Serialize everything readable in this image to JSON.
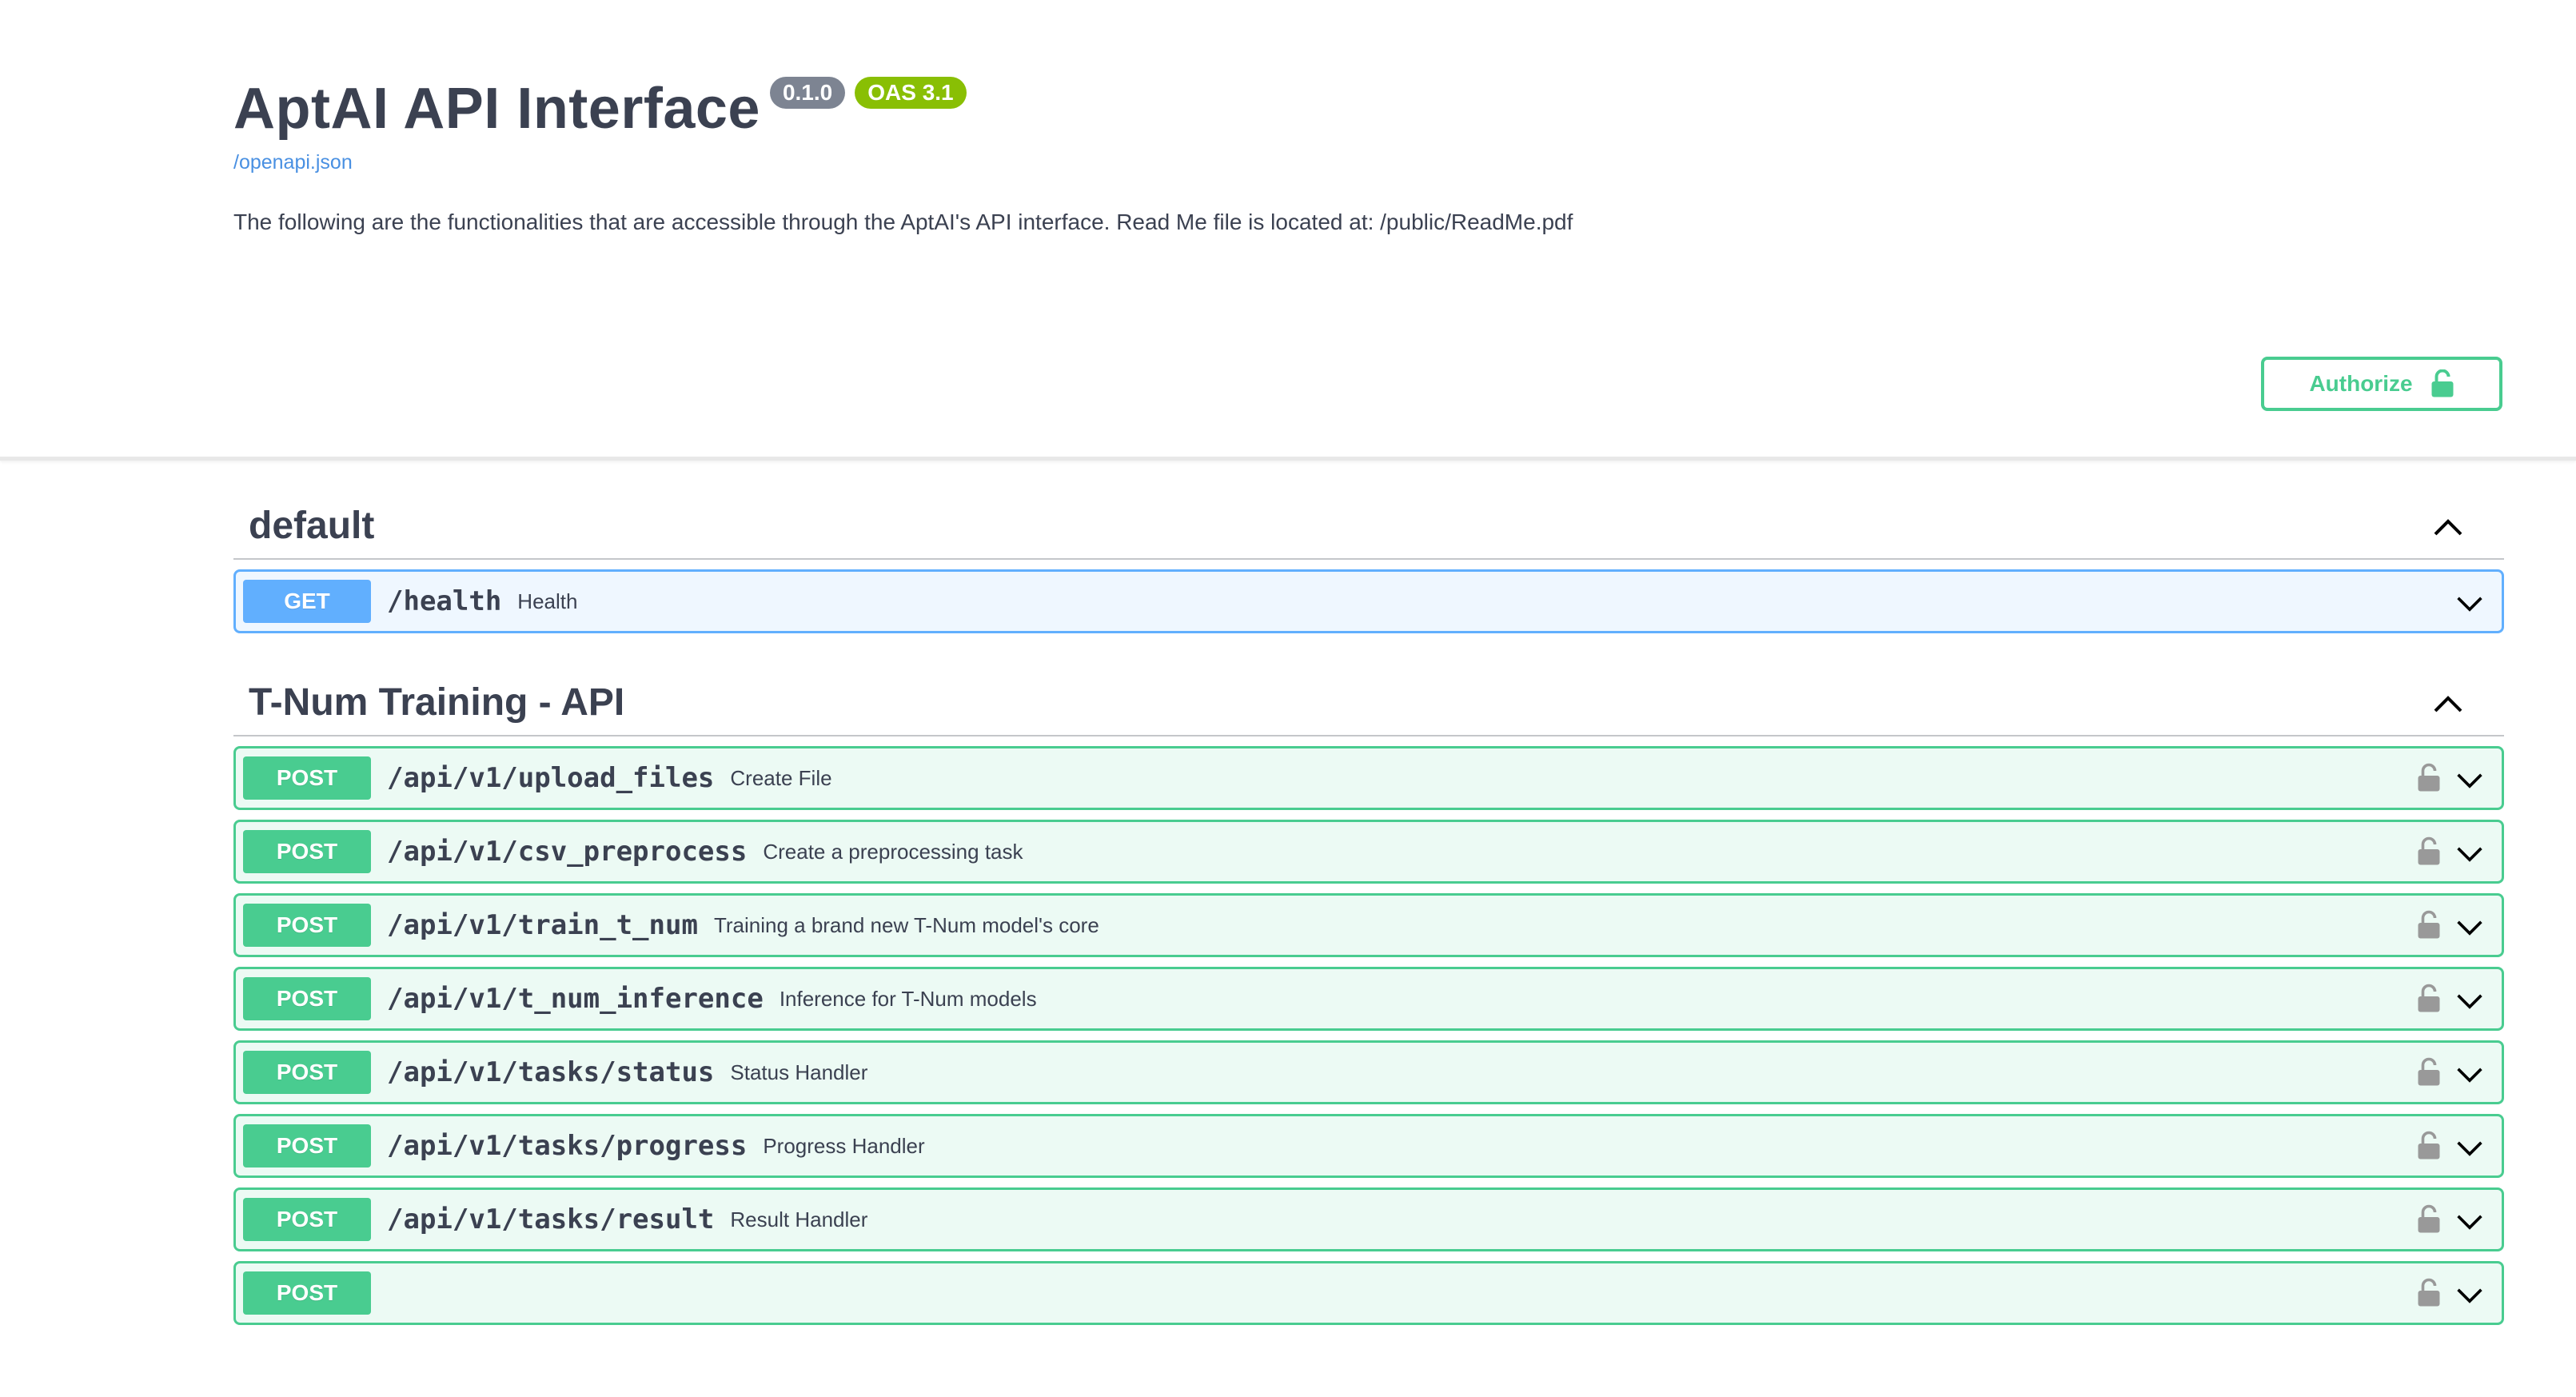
{
  "info": {
    "title": "AptAI API Interface",
    "version": "0.1.0",
    "oas": "OAS 3.1",
    "spec_link": "/openapi.json",
    "description": "The following are the functionalities that are accessible through the AptAI's API interface. Read Me file is located at: /public/ReadMe.pdf"
  },
  "authorize": {
    "label": "Authorize",
    "icon": "unlocked-lock-icon"
  },
  "colors": {
    "get": "#61affe",
    "post": "#49cc90",
    "text": "#3b4151",
    "link": "#4990e2",
    "version_badge": "#7d8492",
    "oas_badge": "#89bf04"
  },
  "sections": [
    {
      "name": "default",
      "operations": [
        {
          "method": "GET",
          "path": "/health",
          "summary": "Health",
          "locked": false
        }
      ]
    },
    {
      "name": "T-Num Training - API",
      "operations": [
        {
          "method": "POST",
          "path": "/api/v1/upload_files",
          "summary": "Create File",
          "locked": true
        },
        {
          "method": "POST",
          "path": "/api/v1/csv_preprocess",
          "summary": "Create a preprocessing task",
          "locked": true
        },
        {
          "method": "POST",
          "path": "/api/v1/train_t_num",
          "summary": "Training a brand new T-Num model's core",
          "locked": true
        },
        {
          "method": "POST",
          "path": "/api/v1/t_num_inference",
          "summary": "Inference for T-Num models",
          "locked": true
        },
        {
          "method": "POST",
          "path": "/api/v1/tasks/status",
          "summary": "Status Handler",
          "locked": true
        },
        {
          "method": "POST",
          "path": "/api/v1/tasks/progress",
          "summary": "Progress Handler",
          "locked": true
        },
        {
          "method": "POST",
          "path": "/api/v1/tasks/result",
          "summary": "Result Handler",
          "locked": true
        },
        {
          "method": "POST",
          "path": "",
          "summary": "",
          "locked": true
        }
      ]
    }
  ]
}
